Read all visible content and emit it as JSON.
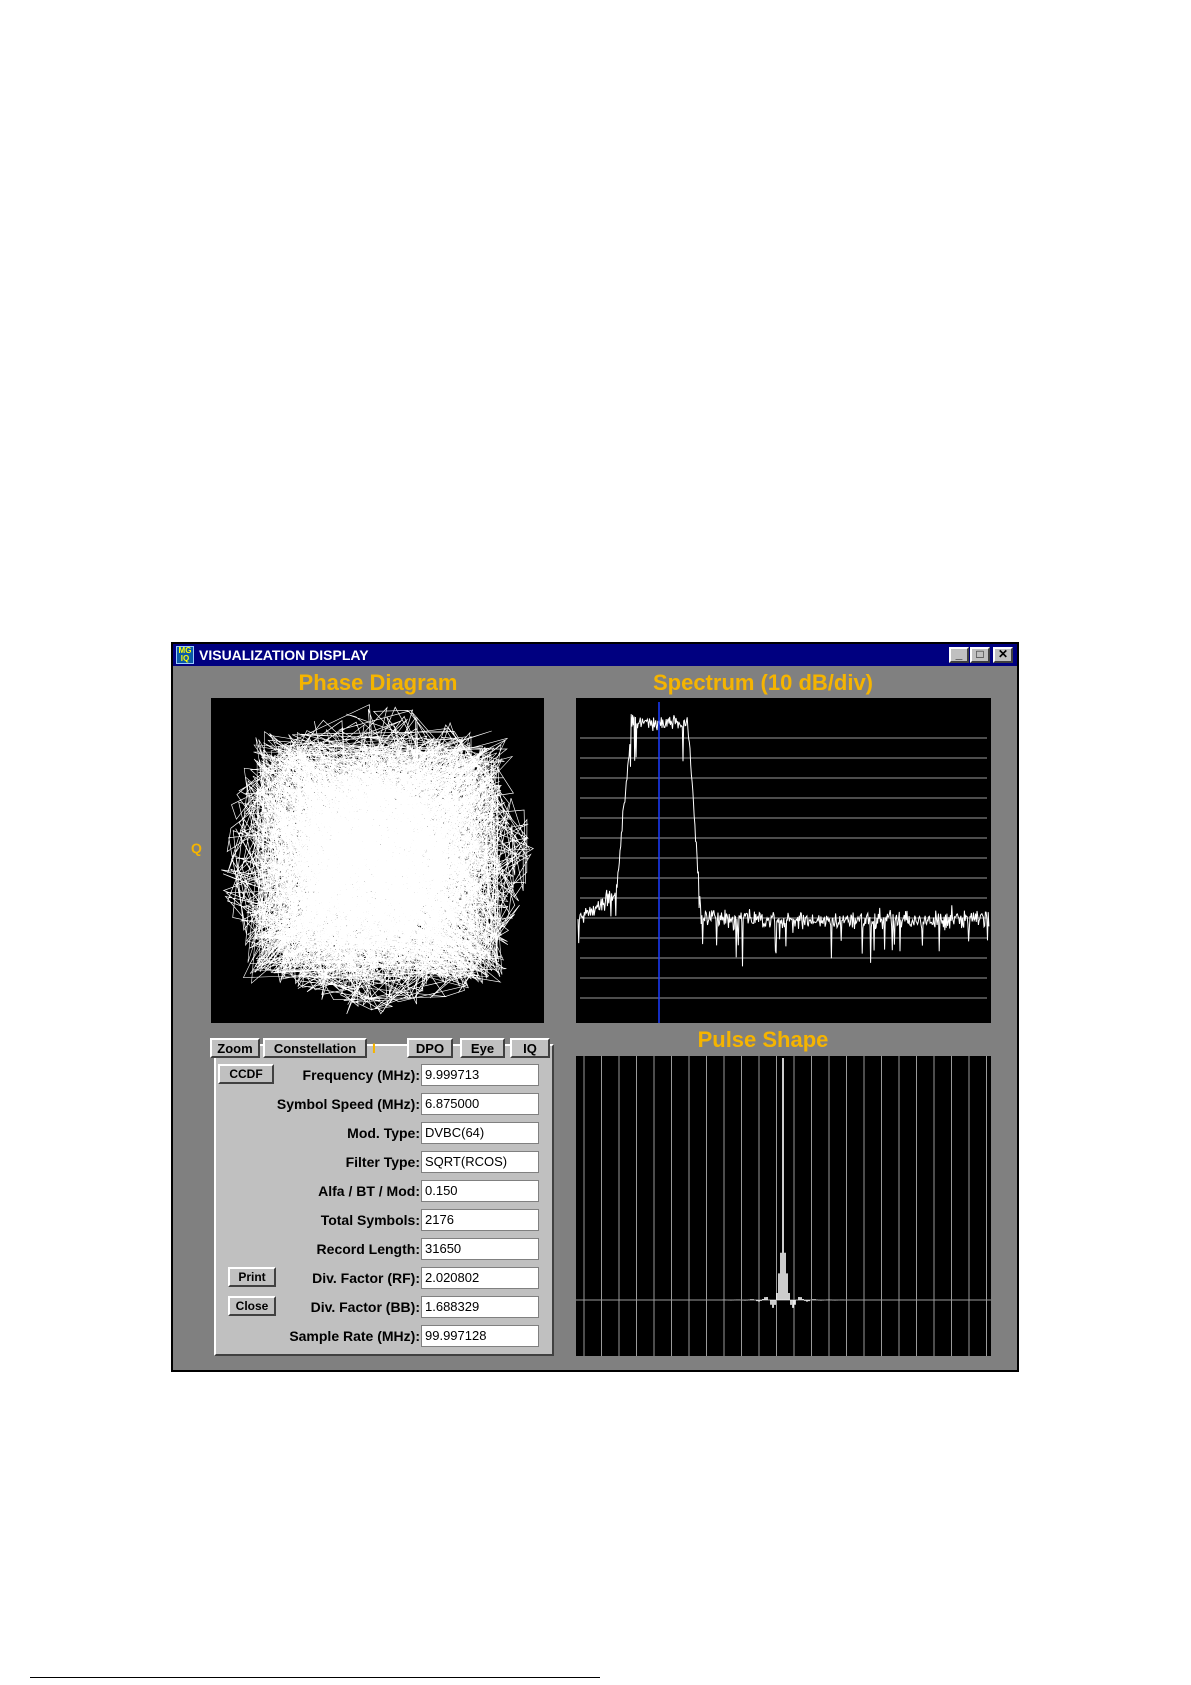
{
  "window": {
    "title": "VISUALIZATION DISPLAY",
    "app_icon_text": "MG IQ",
    "minimize": "_",
    "maximize": "□",
    "close": "✕"
  },
  "phase": {
    "title": "Phase Diagram",
    "q_label": "Q",
    "i_label": "I"
  },
  "spectrum": {
    "title": "Spectrum (10 dB/div)"
  },
  "pulse": {
    "title": "Pulse Shape"
  },
  "buttons": {
    "zoom": "Zoom",
    "constellation": "Constellation",
    "dpo": "DPO",
    "eye": "Eye",
    "iq": "IQ",
    "ccdf": "CCDF",
    "print": "Print",
    "close": "Close"
  },
  "params": [
    {
      "label": "Frequency (MHz):",
      "value": "9.999713"
    },
    {
      "label": "Symbol Speed (MHz):",
      "value": "6.875000"
    },
    {
      "label": "Mod. Type:",
      "value": "DVBC(64)"
    },
    {
      "label": "Filter Type:",
      "value": "SQRT(RCOS)"
    },
    {
      "label": "Alfa / BT / Mod:",
      "value": "0.150"
    },
    {
      "label": "Total Symbols:",
      "value": "2176"
    },
    {
      "label": "Record Length:",
      "value": "31650"
    },
    {
      "label": "Div. Factor (RF):",
      "value": "2.020802"
    },
    {
      "label": "Div. Factor (BB):",
      "value": "1.688329"
    },
    {
      "label": "Sample Rate (MHz):",
      "value": "99.997128"
    }
  ],
  "colors": {
    "title_bar": "#000080",
    "accent_text": "#f5b400",
    "plot_bg": "#000000",
    "trace": "#ffffff",
    "marker": "#1a3cff",
    "grid": "#9a9a9a"
  }
}
